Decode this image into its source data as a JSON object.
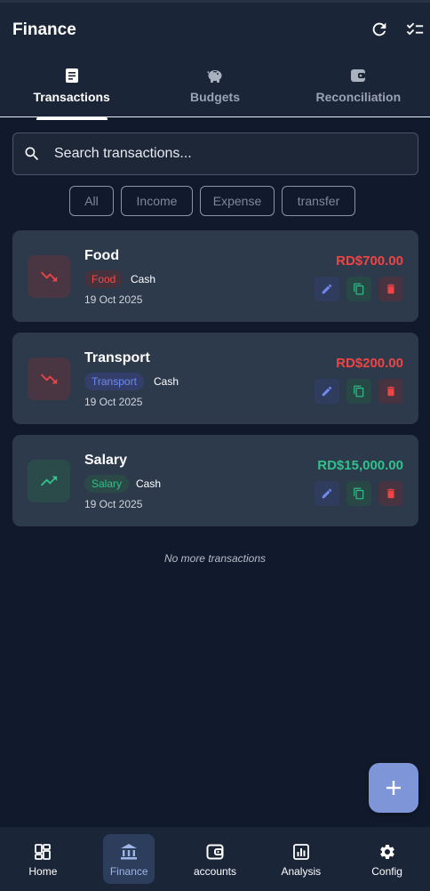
{
  "header": {
    "title": "Finance",
    "refresh_icon": "refresh-icon",
    "checklist_icon": "checklist-icon"
  },
  "tabs": [
    {
      "label": "Transactions",
      "icon": "receipt-icon",
      "active": true
    },
    {
      "label": "Budgets",
      "icon": "piggy-bank-icon",
      "active": false
    },
    {
      "label": "Reconciliation",
      "icon": "wallet-icon",
      "active": false
    }
  ],
  "search": {
    "placeholder": "Search transactions..."
  },
  "filters": [
    "All",
    "Income",
    "Expense",
    "transfer"
  ],
  "transactions": [
    {
      "name": "Food",
      "category": "Food",
      "account": "Cash",
      "date": "19 Oct 2025",
      "amount": "RD$700.00",
      "type": "expense"
    },
    {
      "name": "Transport",
      "category": "Transport",
      "account": "Cash",
      "date": "19 Oct 2025",
      "amount": "RD$200.00",
      "type": "expense"
    },
    {
      "name": "Salary",
      "category": "Salary",
      "account": "Cash",
      "date": "19 Oct 2025",
      "amount": "RD$15,000.00",
      "type": "income"
    }
  ],
  "end_note": "No more transactions",
  "fab": {
    "icon": "plus-icon"
  },
  "bottom_nav": [
    {
      "label": "Home",
      "icon": "dashboard-icon",
      "active": false
    },
    {
      "label": "Finance",
      "icon": "bank-icon",
      "active": true
    },
    {
      "label": "accounts",
      "icon": "wallet-icon",
      "active": false
    },
    {
      "label": "Analysis",
      "icon": "bar-chart-icon",
      "active": false
    },
    {
      "label": "Config",
      "icon": "gear-icon",
      "active": false
    }
  ],
  "colors": {
    "background": "#111a2c",
    "card": "#2d3a4b",
    "expense": "#ef4444",
    "income": "#2fc28c",
    "transfer_tag": "#6e8af0",
    "fab": "#7e96d8"
  }
}
